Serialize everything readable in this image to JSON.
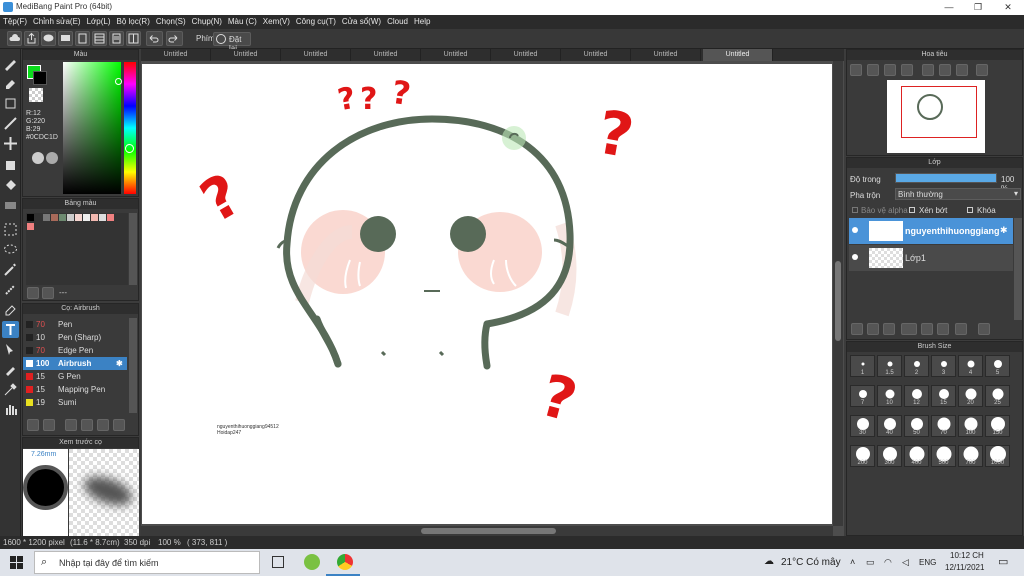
{
  "window": {
    "title": "MediBang Paint Pro (64bit)",
    "minimize": "—",
    "maximize": "❐",
    "close": "✕"
  },
  "menu": [
    "Tệp(F)",
    "Chỉnh sửa(E)",
    "Lớp(L)",
    "Bộ lọc(R)",
    "Chọn(S)",
    "Chụp(N)",
    "Màu (C)",
    "Xem(V)",
    "Công cụ(T)",
    "Cửa sổ(W)",
    "Cloud",
    "Help"
  ],
  "toolbar": {
    "key_label": "Phím",
    "reset_label": "Đặt lại"
  },
  "color_panel": {
    "title": "Màu",
    "r": "R:12",
    "g": "G:220",
    "b": "B:29",
    "hex": "#0CDC1D",
    "fg_color": "#0CDC1D",
    "bg_color": "#000000"
  },
  "palette_panel": {
    "title": "Bảng màu",
    "input": "---"
  },
  "brush_panel": {
    "title": "Cọ: Airbrush",
    "items": [
      {
        "size": "70",
        "name": "Pen",
        "color": "#222222"
      },
      {
        "size": "10",
        "name": "Pen (Sharp)",
        "color": "#222222"
      },
      {
        "size": "70",
        "name": "Edge Pen",
        "color": "#222222"
      },
      {
        "size": "100",
        "name": "Airbrush",
        "color": "#ffffff",
        "selected": true
      },
      {
        "size": "15",
        "name": "G Pen",
        "color": "#e02020"
      },
      {
        "size": "15",
        "name": "Mapping Pen",
        "color": "#e02020"
      },
      {
        "size": "19",
        "name": "Sumi",
        "color": "#e8e020"
      }
    ]
  },
  "preview_panel": {
    "title": "Xem trước cọ",
    "size": "7.26mm"
  },
  "tabs": [
    "Untitled",
    "Untitled",
    "Untitled",
    "Untitled",
    "Untitled",
    "Untitled",
    "Untitled",
    "Untitled",
    "Untitled"
  ],
  "canvas": {
    "signature_line1": "nguyenthihuonggiang94512",
    "signature_line2": "Hoidap247"
  },
  "navigator_panel": {
    "title": "Hoa tiêu"
  },
  "layer_panel": {
    "title": "Lớp",
    "opacity_label": "Độ trong",
    "opacity_value": "100 %",
    "opacity_pct": 100,
    "blend_label": "Pha trộn",
    "blend_value": "Bình thường",
    "protect_alpha": "Bảo vệ alpha",
    "clip": "Xén bớt",
    "lock": "Khóa",
    "layers": [
      {
        "name": "nguyenthihuonggiang",
        "selected": true
      },
      {
        "name": "Lớp1",
        "selected": false
      }
    ]
  },
  "brush_size_panel": {
    "title": "Brush Size",
    "sizes": [
      "1",
      "1.5",
      "2",
      "3",
      "4",
      "5",
      "7",
      "10",
      "12",
      "15",
      "20",
      "25",
      "30",
      "40",
      "50",
      "70",
      "100",
      "150",
      "200",
      "300",
      "400",
      "500",
      "700",
      "1000"
    ]
  },
  "status": {
    "dimensions": "1600 * 1200 pixel",
    "physical": "(11.6 * 8.7cm)",
    "dpi": "350 dpi",
    "zoom": "100 %",
    "coords": "( 373, 811 )"
  },
  "taskbar": {
    "search_placeholder": "Nhập tại đây để tìm kiếm",
    "weather": "21°C  Có mây",
    "lang": "ENG",
    "time": "10:12 CH",
    "date": "12/11/2021"
  }
}
